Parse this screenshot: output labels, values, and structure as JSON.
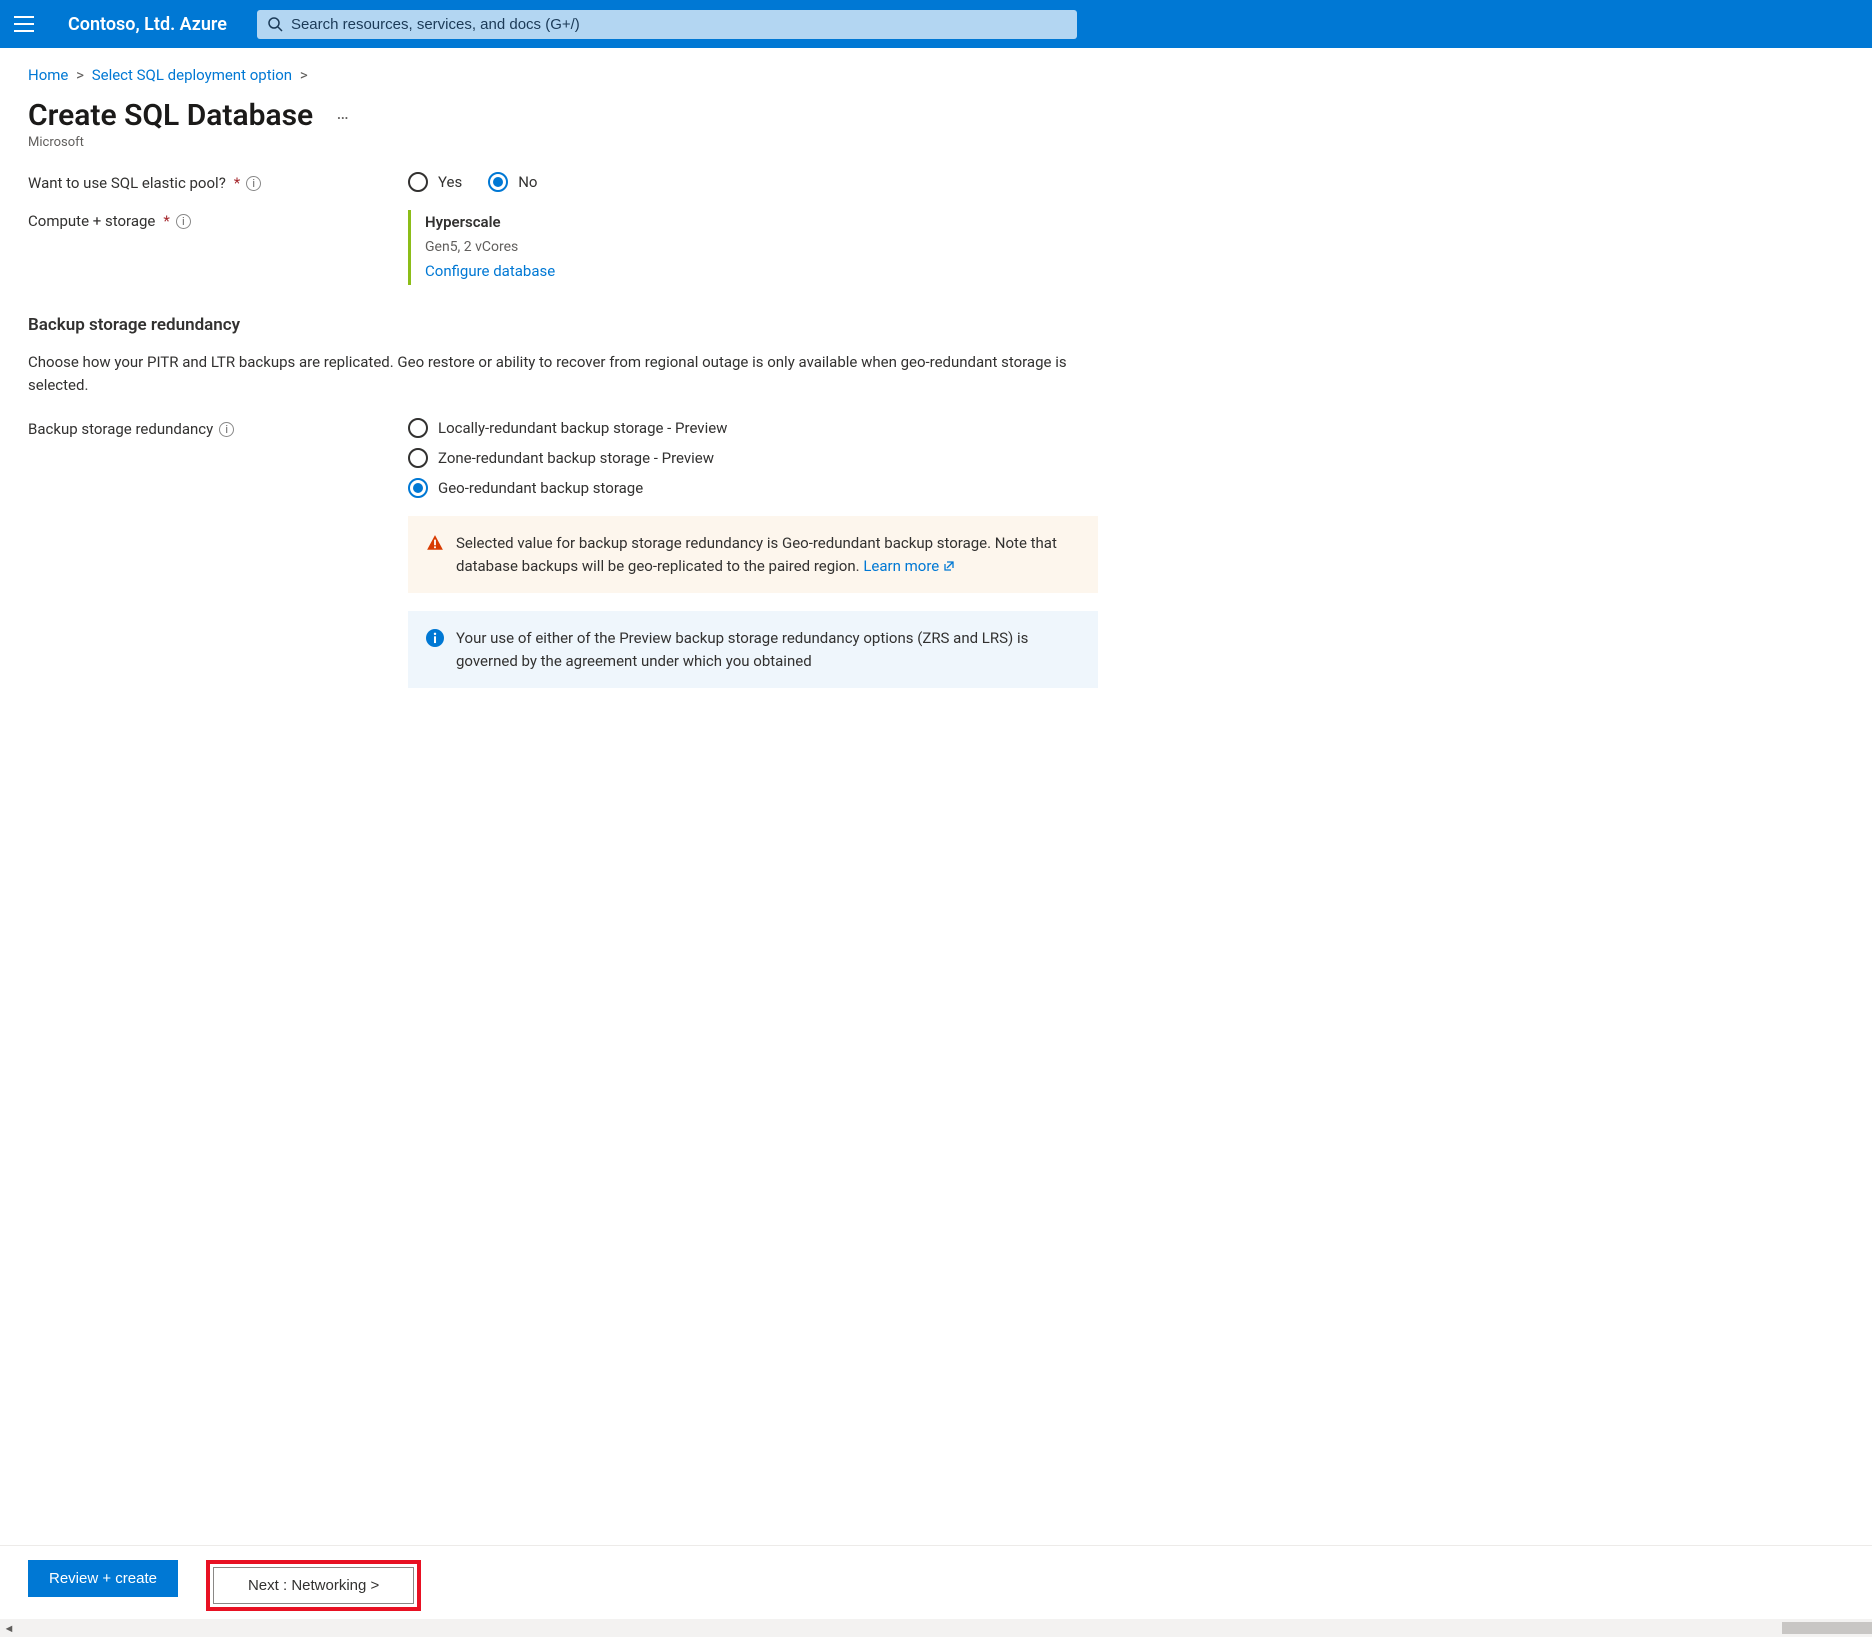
{
  "header": {
    "brand": "Contoso, Ltd. Azure",
    "search_placeholder": "Search resources, services, and docs (G+/)"
  },
  "breadcrumb": {
    "items": [
      "Home",
      "Select SQL deployment option"
    ],
    "separator": ">"
  },
  "page": {
    "title": "Create SQL Database",
    "subtitle": "Microsoft",
    "more": "…"
  },
  "form": {
    "elastic_pool": {
      "label": "Want to use SQL elastic pool?",
      "required_marker": "*",
      "options": [
        "Yes",
        "No"
      ],
      "selected": "No"
    },
    "compute": {
      "label": "Compute + storage",
      "required_marker": "*",
      "tier": "Hyperscale",
      "spec": "Gen5, 2 vCores",
      "configure_link": "Configure database"
    }
  },
  "backup": {
    "heading": "Backup storage redundancy",
    "description": "Choose how your PITR and LTR backups are replicated. Geo restore or ability to recover from regional outage is only available when geo-redundant storage is selected.",
    "field_label": "Backup storage redundancy",
    "options": [
      "Locally-redundant backup storage - Preview",
      "Zone-redundant backup storage - Preview",
      "Geo-redundant backup storage"
    ],
    "selected": "Geo-redundant backup storage",
    "warning_text": "Selected value for backup storage redundancy is Geo-redundant backup storage. Note that database backups will be geo-replicated to the paired region. ",
    "warning_link": "Learn more",
    "info_text": "Your use of either of the Preview backup storage redundancy options (ZRS and LRS) is governed by the agreement under which you obtained"
  },
  "footer": {
    "review": "Review + create",
    "next": "Next : Networking >"
  }
}
